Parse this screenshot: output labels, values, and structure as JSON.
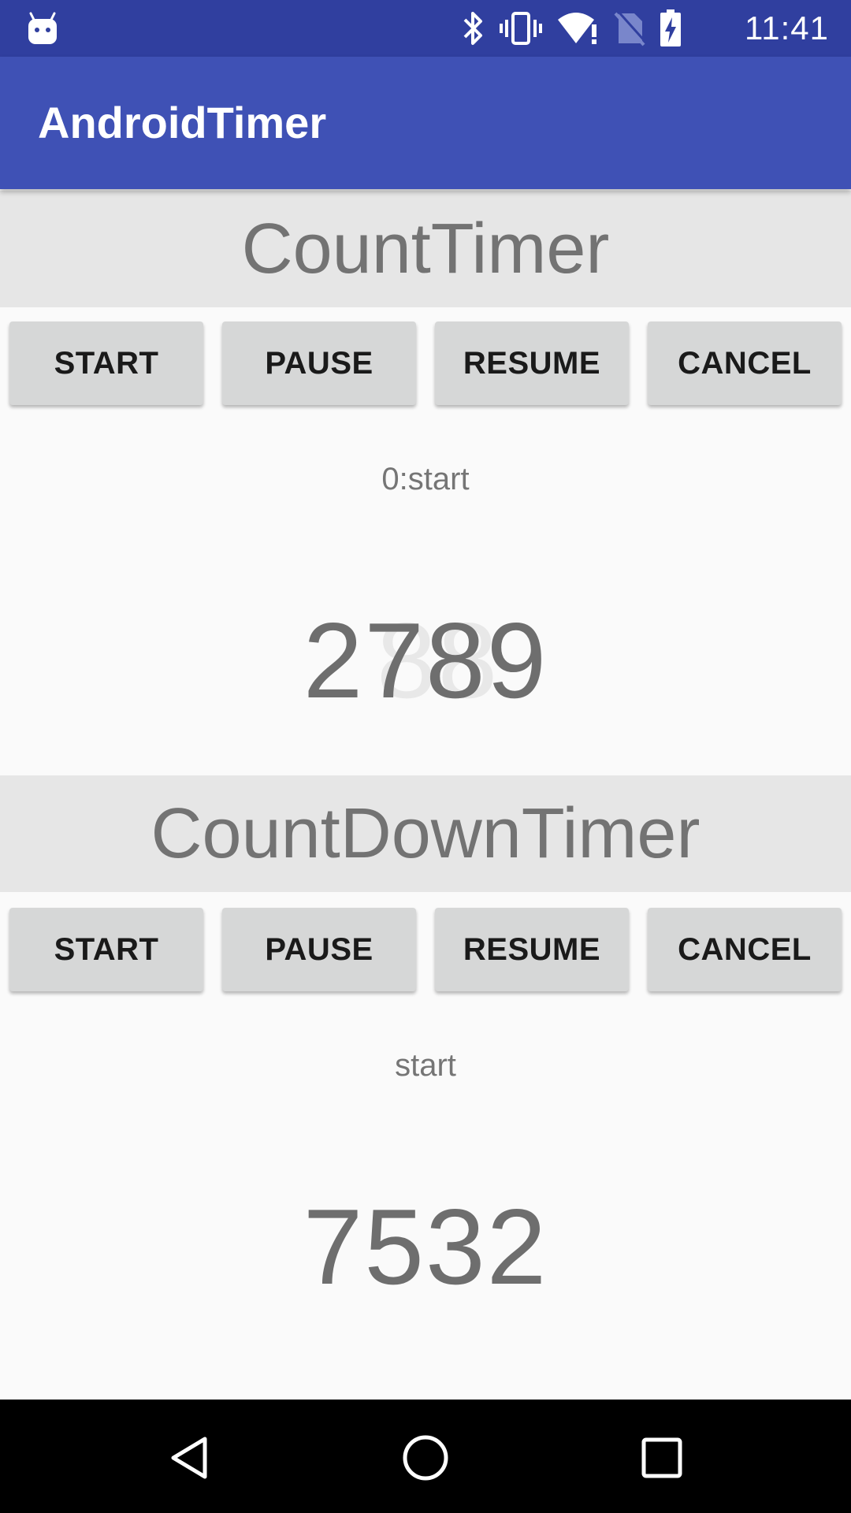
{
  "status_bar": {
    "time": "11:41",
    "icons": [
      "android-debug-icon",
      "bluetooth-icon",
      "vibrate-icon",
      "wifi-alert-icon",
      "no-sim-icon",
      "battery-charging-icon"
    ]
  },
  "app_bar": {
    "title": "AndroidTimer"
  },
  "count_timer": {
    "header": "CountTimer",
    "buttons": {
      "start": "START",
      "pause": "PAUSE",
      "resume": "RESUME",
      "cancel": "CANCEL"
    },
    "status": "0:start",
    "value": "2789",
    "ghost_value": "88"
  },
  "countdown_timer": {
    "header": "CountDownTimer",
    "buttons": {
      "start": "START",
      "pause": "PAUSE",
      "resume": "RESUME",
      "cancel": "CANCEL"
    },
    "status": "start",
    "value": "7532"
  },
  "colors": {
    "status_bar": "#303f9f",
    "app_bar": "#3f51b5",
    "section_header": "#e6e6e6",
    "button": "#d6d7d7",
    "background": "#fafafa"
  }
}
